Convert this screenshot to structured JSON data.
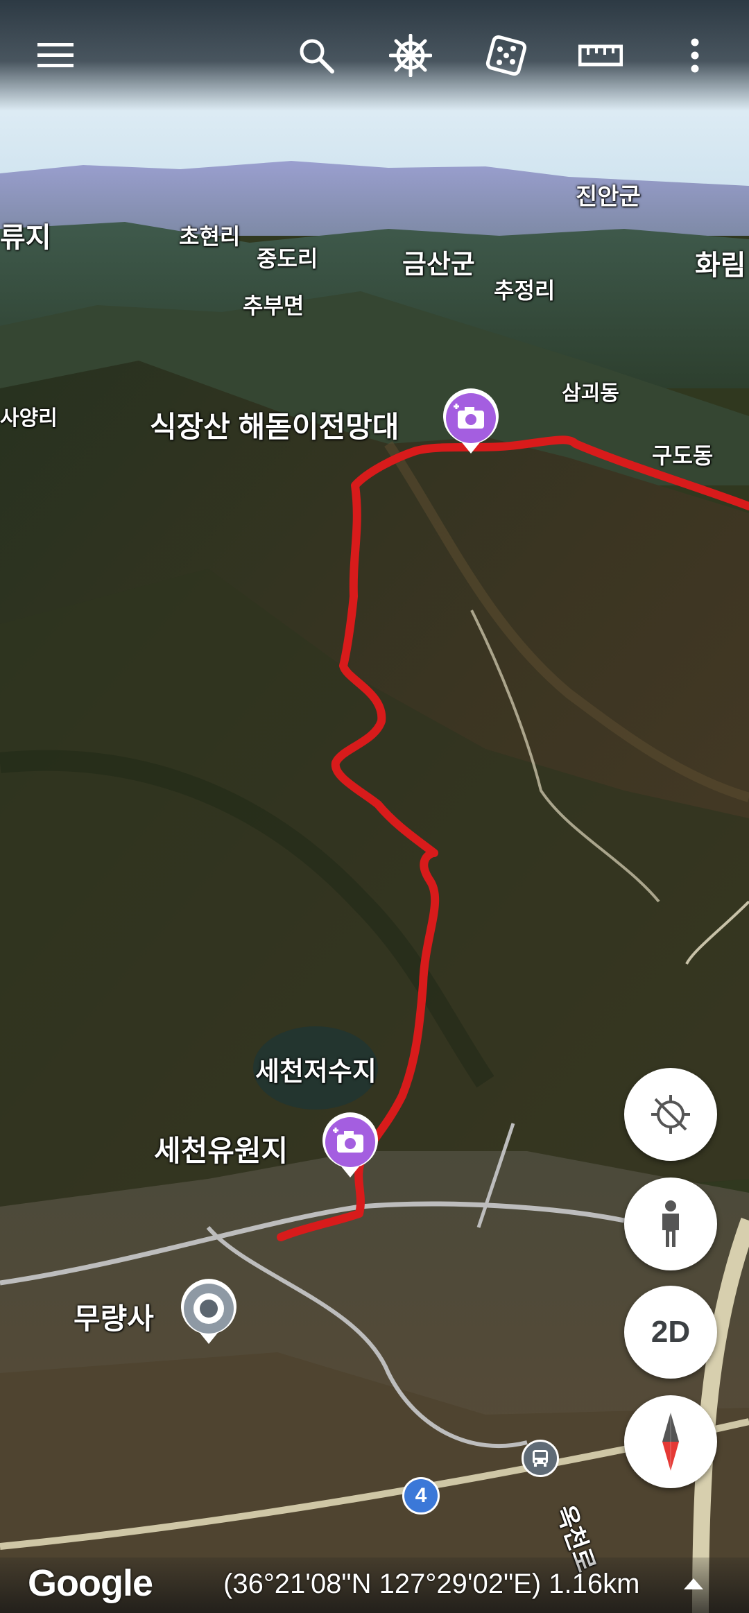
{
  "toolbar": {
    "menu_icon": "menu-icon",
    "search_icon": "search-icon",
    "voyager_icon": "ship-wheel-icon",
    "feeling_lucky_icon": "dice-icon",
    "measure_icon": "ruler-icon",
    "more_icon": "more-vert-icon"
  },
  "map": {
    "place_labels": [
      "진안군",
      "초현리",
      "류지",
      "중도리",
      "금산군",
      "화림",
      "추정리",
      "추부면",
      "삼괴동",
      "사양리",
      "구도동",
      "세천저수지",
      "무량사"
    ],
    "photo_pois": [
      {
        "name": "식장산 해돋이전망대",
        "icon": "camera-plus-icon"
      },
      {
        "name": "세천유원지",
        "icon": "camera-plus-icon"
      }
    ],
    "place_poi": {
      "name": "무량사",
      "icon": "location-pin-icon"
    },
    "route_shield": "4",
    "transit_icon": "bus-icon",
    "road_label": "옥천로",
    "track_color": "#d81b1b"
  },
  "controls": {
    "location_icon": "location-disabled-icon",
    "pegman_icon": "pegman-icon",
    "view_toggle_label": "2D",
    "compass_icon": "compass-icon"
  },
  "footer": {
    "logo": "Google",
    "coordinates": "(36°21'08\"N 127°29'02\"E) 1.16km",
    "expand_icon": "caret-up-icon"
  }
}
